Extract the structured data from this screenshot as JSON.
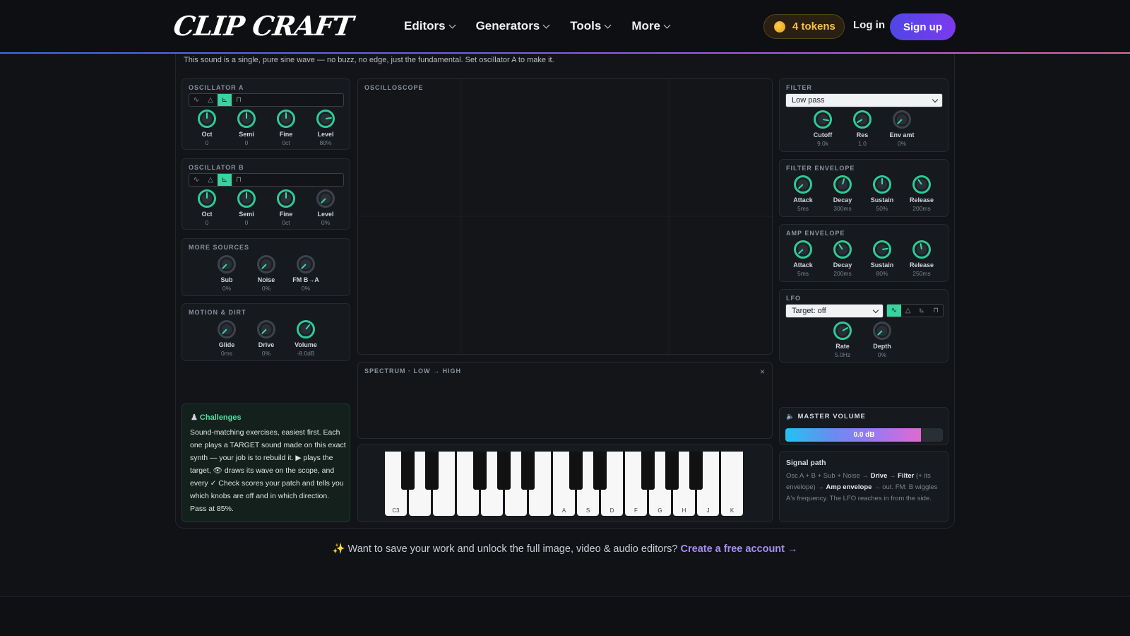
{
  "brand": {
    "logo_text": "CLIP CRAFT"
  },
  "nav": {
    "items": [
      "Editors",
      "Generators",
      "Tools",
      "More"
    ]
  },
  "header": {
    "tokens": "4 tokens",
    "login": "Log in",
    "signup": "Sign up"
  },
  "intro": "This sound is a single, pure sine wave — no buzz, no edge, just the fundamental. Set oscillator A to make it.",
  "wave_icons": [
    "∿",
    "△",
    "⊾",
    "⊓"
  ],
  "osc_a": {
    "title": "OSCILLATOR A",
    "selected_wave": 2,
    "knobs": [
      {
        "label": "Oct",
        "value": "0"
      },
      {
        "label": "Semi",
        "value": "0"
      },
      {
        "label": "Fine",
        "value": "0ct"
      },
      {
        "label": "Level",
        "value": "80%"
      }
    ]
  },
  "osc_b": {
    "title": "OSCILLATOR B",
    "selected_wave": 2,
    "knobs": [
      {
        "label": "Oct",
        "value": "0"
      },
      {
        "label": "Semi",
        "value": "0"
      },
      {
        "label": "Fine",
        "value": "0ct"
      },
      {
        "label": "Level",
        "value": "0%"
      }
    ]
  },
  "more_sources": {
    "title": "MORE SOURCES",
    "knobs": [
      {
        "label": "Sub",
        "value": "0%"
      },
      {
        "label": "Noise",
        "value": "0%"
      },
      {
        "label": "FM B→A",
        "value": "0%"
      }
    ]
  },
  "motion": {
    "title": "MOTION & DIRT",
    "knobs": [
      {
        "label": "Glide",
        "value": "0ms"
      },
      {
        "label": "Drive",
        "value": "0%"
      },
      {
        "label": "Volume",
        "value": "-8.0dB"
      }
    ]
  },
  "oscilloscope": {
    "title": "OSCILLOSCOPE"
  },
  "spectrum": {
    "title": "SPECTRUM · LOW → HIGH",
    "close": "×"
  },
  "filter": {
    "title": "FILTER",
    "type": "Low pass",
    "knobs": [
      {
        "label": "Cutoff",
        "value": "9.0k"
      },
      {
        "label": "Res",
        "value": "1.0"
      },
      {
        "label": "Env amt",
        "value": "0%"
      }
    ]
  },
  "filter_env": {
    "title": "FILTER ENVELOPE",
    "knobs": [
      {
        "label": "Attack",
        "value": "5ms"
      },
      {
        "label": "Decay",
        "value": "300ms"
      },
      {
        "label": "Sustain",
        "value": "50%"
      },
      {
        "label": "Release",
        "value": "200ms"
      }
    ]
  },
  "amp_env": {
    "title": "AMP ENVELOPE",
    "knobs": [
      {
        "label": "Attack",
        "value": "5ms"
      },
      {
        "label": "Decay",
        "value": "200ms"
      },
      {
        "label": "Sustain",
        "value": "80%"
      },
      {
        "label": "Release",
        "value": "250ms"
      }
    ]
  },
  "lfo": {
    "title": "LFO",
    "target": "Target: off",
    "selected_wave": 0,
    "knobs": [
      {
        "label": "Rate",
        "value": "5.0Hz"
      },
      {
        "label": "Depth",
        "value": "0%"
      }
    ]
  },
  "master": {
    "title": "MASTER VOLUME",
    "value": "0.0 dB",
    "level": 0.86
  },
  "signal_path": {
    "title": "Signal path",
    "parts": [
      {
        "t": "Osc A + B + Sub + Noise → ",
        "b": false
      },
      {
        "t": "Drive",
        "b": true
      },
      {
        "t": " → ",
        "b": false
      },
      {
        "t": "Filter",
        "b": true
      },
      {
        "t": " (+ its envelope) → ",
        "b": false
      },
      {
        "t": "Amp envelope",
        "b": true
      },
      {
        "t": " → out. FM: B wiggles A's frequency. The LFO reaches in from the side.",
        "b": false
      }
    ]
  },
  "challenges": {
    "title": "Challenges",
    "text": "Sound-matching exercises, easiest first. Each one plays a TARGET sound made on this exact synth — your job is to rebuild it. ▶ plays the target, 👁 draws its wave on the scope, and every ✓ Check scores your patch and tells you which knobs are off and in which direction. Pass at 85%."
  },
  "keyboard": {
    "white_labels": [
      "C3",
      "",
      "",
      "",
      "",
      "",
      "",
      "A",
      "S",
      "D",
      "F",
      "G",
      "H",
      "J",
      "K"
    ]
  },
  "footer": {
    "sparkle": "✨",
    "text": " Want to save your work and unlock the full image, video & audio editors? ",
    "link": "Create a free account →"
  },
  "colors": {
    "accent": "#38d39f",
    "signup": "#5b3ff0",
    "token": "#f6c14a"
  }
}
